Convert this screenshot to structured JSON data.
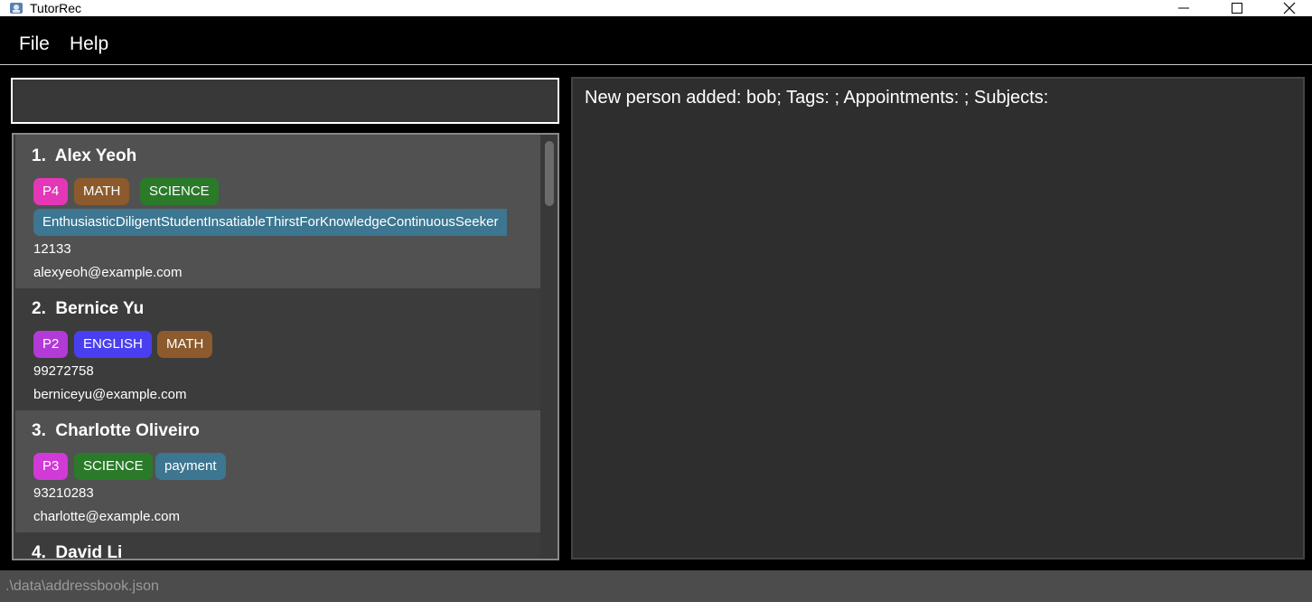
{
  "window": {
    "title": "TutorRec"
  },
  "menu": {
    "file": "File",
    "help": "Help"
  },
  "command": {
    "value": ""
  },
  "persons": [
    {
      "index": "1.",
      "name": "Alex Yeoh",
      "tags": [
        {
          "text": "P4",
          "color": "#e337b8"
        },
        {
          "text": "MATH",
          "color": "#8c5a2c"
        },
        {
          "text": "SCIENCE",
          "color": "#2a7a2a"
        }
      ],
      "long_tag": {
        "text": "EnthusiasticDiligentStudentInsatiableThirstForKnowledgeContinuousSeeker",
        "color": "#3d7691"
      },
      "phone": "12133",
      "email": "alexyeoh@example.com"
    },
    {
      "index": "2.",
      "name": "Bernice Yu",
      "tags": [
        {
          "text": "P2",
          "color": "#b23ad6"
        },
        {
          "text": "ENGLISH",
          "color": "#4a3ff0"
        },
        {
          "text": "MATH",
          "color": "#8c5a2c"
        }
      ],
      "phone": "99272758",
      "email": "berniceyu@example.com"
    },
    {
      "index": "3.",
      "name": "Charlotte Oliveiro",
      "tags": [
        {
          "text": "P3",
          "color": "#d13ad6"
        },
        {
          "text": "SCIENCE",
          "color": "#2a7a2a"
        },
        {
          "text": "payment",
          "color": "#3d7691"
        }
      ],
      "phone": "93210283",
      "email": "charlotte@example.com"
    },
    {
      "index": "4.",
      "name": "David Li"
    }
  ],
  "result": {
    "text": "New person added: bob; Tags: ; Appointments: ; Subjects:"
  },
  "status": {
    "path": ".\\data\\addressbook.json"
  },
  "colors": {
    "background": "#000000",
    "card_odd": "#515151",
    "card_even": "#3c3c3c",
    "result_panel": "#2e2e2e",
    "status_bar": "#4c4c4c"
  }
}
